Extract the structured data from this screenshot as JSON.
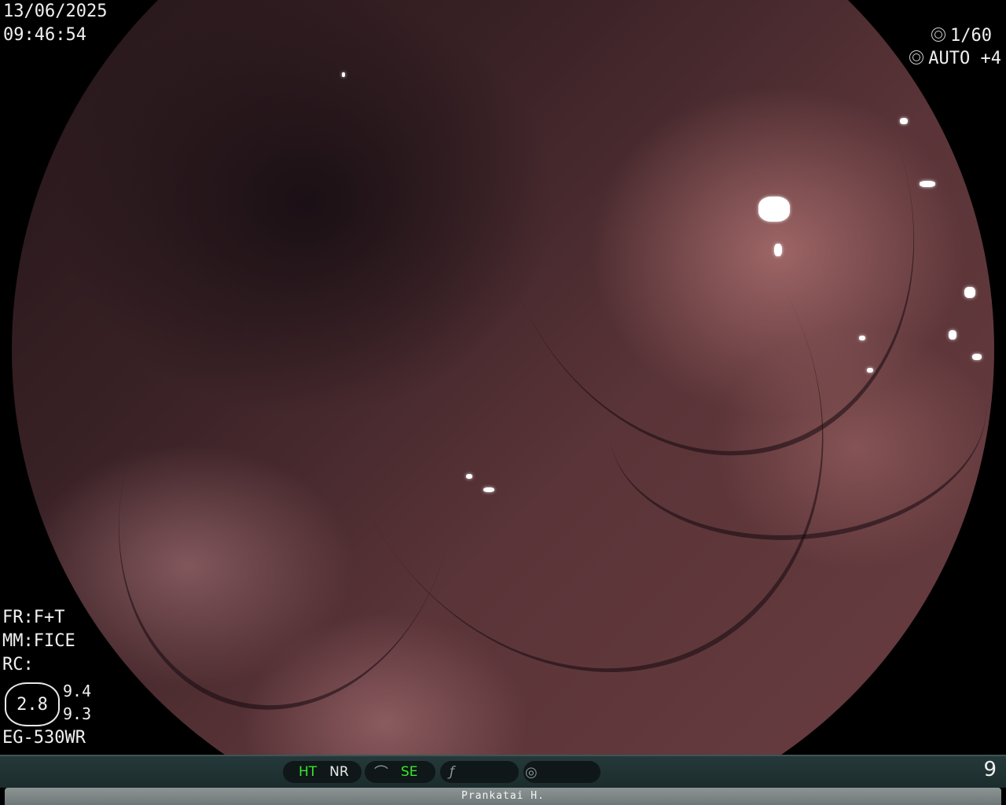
{
  "osd": {
    "date": "13/06/2025",
    "time": "09:46:54",
    "shutter_label": "1/60",
    "iris_label": "AUTO +4",
    "fr": "FR:F+T",
    "mm": "MM:FICE",
    "rc": "RC:",
    "gauge_value": "2.8",
    "gauge_side_top": "9.4",
    "gauge_side_bottom": "9.3",
    "scope_model": "EG-530WR"
  },
  "statusbar": {
    "ht": "HT",
    "nr": "NR",
    "se": "SE",
    "page_number": "9"
  },
  "patient": {
    "name": "Prankatai H."
  },
  "icons": {
    "shutter": "shutter-icon",
    "iris": "iris-icon",
    "curve": "curve-icon",
    "function": "function-icon",
    "gauge": "gauge-icon"
  },
  "colors": {
    "active_mode": "#39e62a",
    "statusbar_bg": "#1c2c2d",
    "namebar_bg": "#7f8888"
  }
}
